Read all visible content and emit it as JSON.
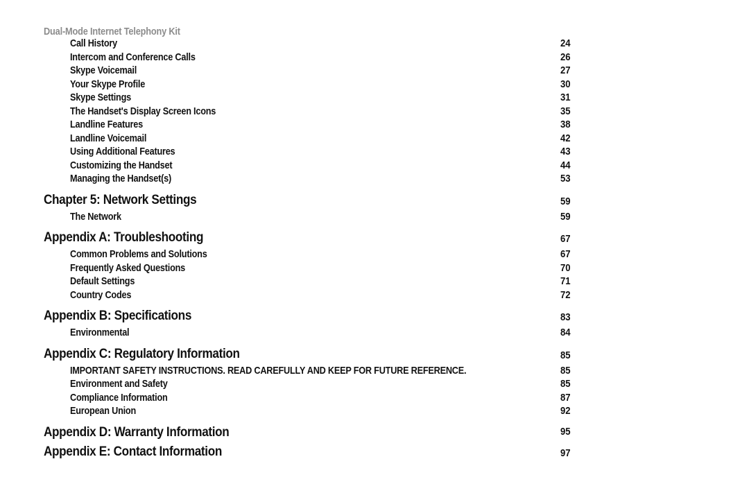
{
  "header": {
    "running_title": "Dual-Mode Internet Telephony Kit",
    "color": "#8c8c8c"
  },
  "document": {
    "type": "table-of-contents",
    "text_color": "#111111"
  },
  "toc": {
    "entries": [
      {
        "level": "sub",
        "title": "Call History",
        "page": "24"
      },
      {
        "level": "sub",
        "title": "Intercom and Conference Calls",
        "page": "26"
      },
      {
        "level": "sub",
        "title": "Skype Voicemail",
        "page": "27"
      },
      {
        "level": "sub",
        "title": "Your Skype Profile",
        "page": "30"
      },
      {
        "level": "sub",
        "title": "Skype Settings",
        "page": "31"
      },
      {
        "level": "sub",
        "title": "The Handset's Display Screen Icons",
        "page": "35"
      },
      {
        "level": "sub",
        "title": "Landline Features",
        "page": "38"
      },
      {
        "level": "sub",
        "title": "Landline Voicemail",
        "page": "42"
      },
      {
        "level": "sub",
        "title": "Using Additional Features",
        "page": "43"
      },
      {
        "level": "sub",
        "title": "Customizing the Handset",
        "page": "44"
      },
      {
        "level": "sub",
        "title": "Managing the Handset(s)",
        "page": "53"
      },
      {
        "level": "chapter",
        "title": "Chapter 5: Network Settings",
        "page": "59"
      },
      {
        "level": "sub",
        "title": "The Network",
        "page": "59"
      },
      {
        "level": "chapter",
        "title": "Appendix A: Troubleshooting",
        "page": "67"
      },
      {
        "level": "sub",
        "title": "Common Problems and Solutions",
        "page": "67"
      },
      {
        "level": "sub",
        "title": "Frequently Asked Questions",
        "page": "70"
      },
      {
        "level": "sub",
        "title": "Default Settings",
        "page": "71"
      },
      {
        "level": "sub",
        "title": "Country Codes",
        "page": "72"
      },
      {
        "level": "chapter",
        "title": "Appendix B: Specifications",
        "page": "83"
      },
      {
        "level": "sub",
        "title": "Environmental",
        "page": "84"
      },
      {
        "level": "chapter",
        "title": "Appendix C: Regulatory Information",
        "page": "85"
      },
      {
        "level": "sub",
        "title": "IMPORTANT SAFETY INSTRUCTIONS. READ CAREFULLY AND KEEP FOR FUTURE REFERENCE.",
        "page": "85"
      },
      {
        "level": "sub",
        "title": "Environment and Safety",
        "page": "85"
      },
      {
        "level": "sub",
        "title": "Compliance Information",
        "page": "87"
      },
      {
        "level": "sub",
        "title": "European Union",
        "page": "92"
      },
      {
        "level": "chapter",
        "title": "Appendix D: Warranty Information",
        "page": "95"
      },
      {
        "level": "chapter",
        "title": "Appendix E: Contact Information",
        "page": "97"
      }
    ]
  }
}
